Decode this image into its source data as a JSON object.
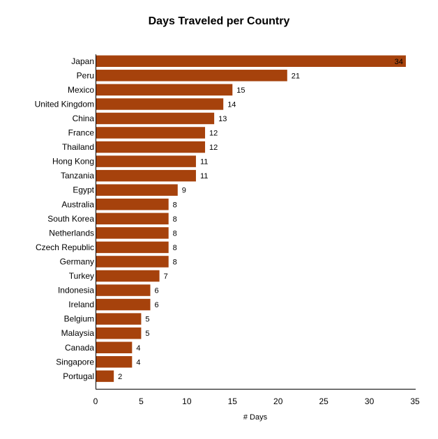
{
  "chart_data": {
    "type": "bar",
    "orientation": "horizontal",
    "title": "Days Traveled per Country",
    "xlabel": "# Days",
    "ylabel": "",
    "xlim": [
      0,
      35
    ],
    "xticks": [
      0,
      5,
      10,
      15,
      20,
      25,
      30,
      35
    ],
    "grid": false,
    "legend": null,
    "bar_color": "#A6420C",
    "categories": [
      "Japan",
      "Peru",
      "Mexico",
      "United Kingdom",
      "China",
      "France",
      "Thailand",
      "Hong Kong",
      "Tanzania",
      "Egypt",
      "Australia",
      "South Korea",
      "Netherlands",
      "Czech Republic",
      "Germany",
      "Turkey",
      "Indonesia",
      "Ireland",
      "Belgium",
      "Malaysia",
      "Canada",
      "Singapore",
      "Portugal"
    ],
    "values": [
      34,
      21,
      15,
      14,
      13,
      12,
      12,
      11,
      11,
      9,
      8,
      8,
      8,
      8,
      8,
      7,
      6,
      6,
      5,
      5,
      4,
      4,
      2
    ]
  }
}
